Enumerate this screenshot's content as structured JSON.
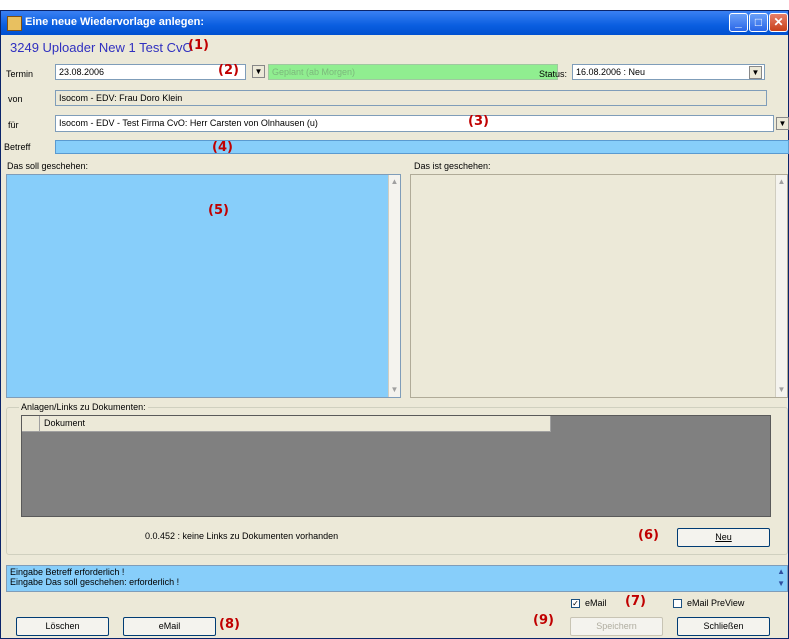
{
  "window": {
    "title": "Eine neue Wiedervorlage anlegen:"
  },
  "header": {
    "title": "3249 Uploader New 1 Test CvO"
  },
  "markers": [
    "(1)",
    "(2)",
    "(3)",
    "(4)",
    "(5)",
    "(6)",
    "(7)",
    "(8)",
    "(9)"
  ],
  "termin": {
    "label": "Termin",
    "value": "23.08.2006",
    "geplant": "Geplant   (ab Morgen)"
  },
  "status": {
    "label": "Status:",
    "value": "16.08.2006 : Neu"
  },
  "von": {
    "label": "von",
    "value": "Isocom - EDV: Frau Doro Klein"
  },
  "fuer": {
    "label": "für",
    "value": "Isocom - EDV - Test Firma CvO: Herr Carsten von Olnhausen (u)"
  },
  "betreff": {
    "label": "Betreff",
    "value": ""
  },
  "soll": {
    "label": "Das soll geschehen:"
  },
  "ist": {
    "label": "Das ist geschehen:"
  },
  "anlagen": {
    "label": "Anlagen/Links zu Dokumenten:",
    "column": "Dokument",
    "info": "0.0.452 : keine Links zu Dokumenten vorhanden",
    "neu_button": "Neu"
  },
  "messages": [
    "Eingabe Betreff erforderlich !",
    "Eingabe Das soll geschehen: erforderlich !"
  ],
  "options": {
    "email_label": "eMail",
    "email_checked": true,
    "preview_label": "eMail PreView",
    "preview_checked": false
  },
  "buttons": {
    "loeschen": "Löschen",
    "email": "eMail",
    "speichern": "Speichern",
    "schliessen": "Schließen"
  },
  "colors": {
    "title_bar": "#0a5ee0",
    "required_field": "#87cefa",
    "geplant": "#90ee90",
    "marker": "#c00000",
    "header_text": "#3030c0"
  }
}
